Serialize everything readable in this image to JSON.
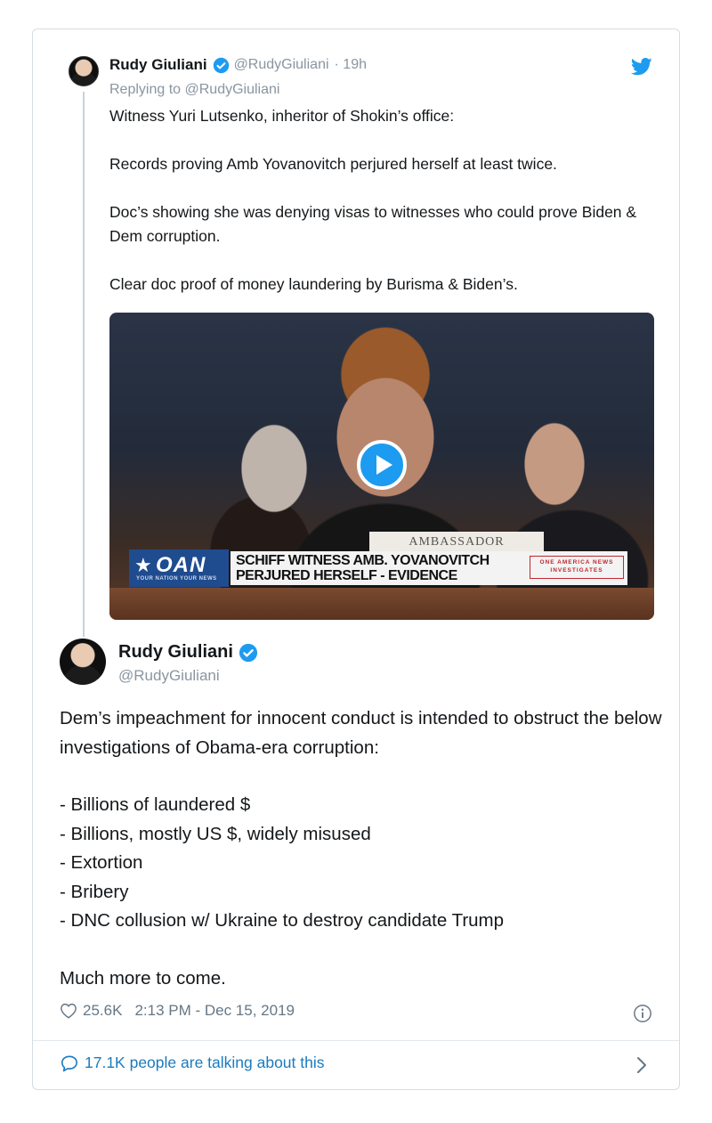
{
  "reply_tweet": {
    "name": "Rudy Giuliani",
    "handle": "@RudyGiuliani",
    "time": "· 19h",
    "replying_prefix": "Replying to",
    "replying_handle": "@RudyGiuliani",
    "paragraphs": [
      "Witness Yuri Lutsenko, inheritor of Shokin’s office:",
      "Records proving Amb Yovanovitch perjured herself at least twice.",
      "Doc’s showing she was denying visas to witnesses who could prove Biden & Dem corruption.",
      "Clear doc proof of money laundering by Burisma & Biden’s."
    ],
    "video": {
      "nameplate": "AMBASSADOR",
      "logo": "OAN",
      "logo_tag": "YOUR NATION  YOUR NEWS",
      "chyron_line1": "SCHIFF WITNESS AMB. YOVANOVITCH",
      "chyron_line2": "PERJURED HERSELF - EVIDENCE",
      "chyron_badge": "ONE AMERICA NEWS INVESTIGATES"
    }
  },
  "main_tweet": {
    "name": "Rudy Giuliani",
    "handle": "@RudyGiuliani",
    "intro": "Dem’s impeachment for innocent conduct is intended to obstruct the below investigations of Obama-era corruption:",
    "list": [
      "- Billions of laundered $",
      "- Billions, mostly US $, widely misused",
      "- Extortion",
      "- Bribery",
      "- DNC collusion w/ Ukraine to destroy candidate Trump"
    ],
    "closing": "Much more to come.",
    "likes": "25.6K",
    "timestamp": "2:13 PM - Dec 15, 2019"
  },
  "footer": {
    "talking": "17.1K people are talking about this"
  },
  "colors": {
    "twitter_blue": "#1d9bf0",
    "link_blue": "#1b7bbd",
    "muted_gray": "#8a95a0"
  },
  "icons": [
    "verified-badge-icon",
    "twitter-bird-icon",
    "play-icon",
    "heart-icon",
    "info-icon",
    "speech-bubble-icon",
    "chevron-right-icon"
  ]
}
